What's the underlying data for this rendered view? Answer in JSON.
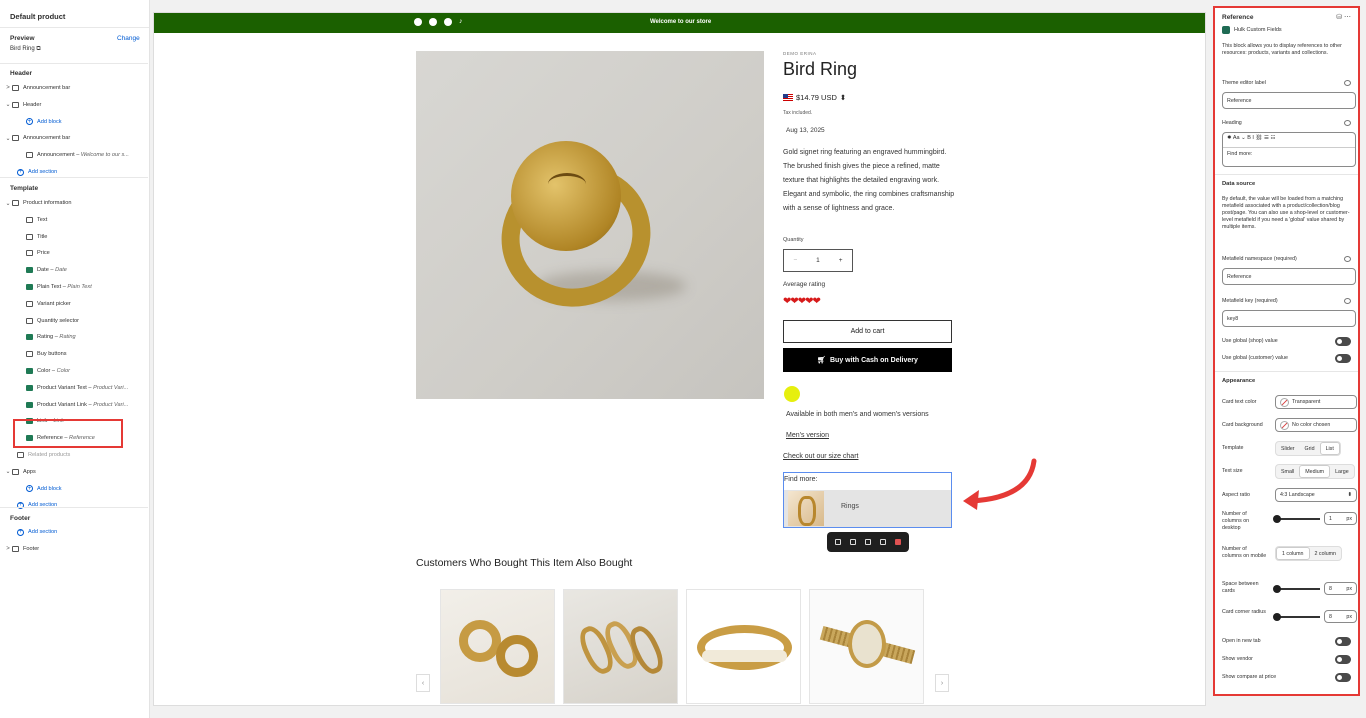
{
  "left": {
    "title": "Default product",
    "preview_label": "Preview",
    "preview_change": "Change",
    "preview_value": "Bird Ring",
    "header_section": "Header",
    "header_items": [
      {
        "label": "Announcement bar",
        "caret": ">",
        "icon": "section-icon"
      },
      {
        "label": "Header",
        "caret": "⌄",
        "icon": "section-icon"
      },
      {
        "label": "Add block",
        "type": "add"
      },
      {
        "label": "Announcement bar",
        "caret": "⌄",
        "icon": "section-icon"
      },
      {
        "label": "Announcement",
        "sub": "Welcome to our s...",
        "icon": "block-icon"
      },
      {
        "label": "Add section",
        "type": "add"
      }
    ],
    "template_section": "Template",
    "template_items": [
      {
        "label": "Product information",
        "caret": "⌄"
      },
      {
        "label": "Text"
      },
      {
        "label": "Title"
      },
      {
        "label": "Price"
      },
      {
        "label": "Date",
        "sub": "Date",
        "app": true
      },
      {
        "label": "Plain Text",
        "sub": "Plain Text",
        "app": true
      },
      {
        "label": "Variant picker"
      },
      {
        "label": "Quantity selector"
      },
      {
        "label": "Rating",
        "sub": "Rating",
        "app": true
      },
      {
        "label": "Buy buttons"
      },
      {
        "label": "Color",
        "sub": "Color",
        "app": true
      },
      {
        "label": "Product Variant Text",
        "sub": "Product Vari...",
        "app": true
      },
      {
        "label": "Product Variant Link",
        "sub": "Product  Vari...",
        "app": true
      },
      {
        "label": "Link",
        "sub": "Link",
        "app": true
      },
      {
        "label": "Reference",
        "sub": "Reference",
        "app": true
      },
      {
        "label": "Related products"
      },
      {
        "label": "Apps",
        "caret": "⌄"
      },
      {
        "label": "Add block",
        "type": "add"
      },
      {
        "label": "Add section",
        "type": "add"
      }
    ],
    "footer_section": "Footer",
    "footer_items": [
      {
        "label": "Add section",
        "type": "add"
      },
      {
        "label": "Footer",
        "caret": ">"
      }
    ]
  },
  "store": {
    "announcement": "Welcome to our store",
    "brand": "DEMO ERINA",
    "title": "Bird Ring",
    "price": "$14.79 USD",
    "tax": "Tax included.",
    "date": "Aug 13, 2025",
    "description": "Gold signet ring featuring an engraved hummingbird. The brushed finish gives the piece a refined, matte texture that highlights the detailed engraving work. Elegant and symbolic, the ring combines craftsmanship with a sense of lightness and grace.",
    "quantity_label": "Quantity",
    "quantity_value": "1",
    "qty_minus": "−",
    "qty_plus": "+",
    "rating_label": "Average rating",
    "rating_value": 4.5,
    "rating_hearts": "❤❤❤❤❤",
    "add_to_cart": "Add to cart",
    "cod": "Buy with Cash on Delivery",
    "color_swatch": "#e6ef0e",
    "availability": "Available in both men's and women's versions",
    "mens_link": "Men's version",
    "size_chart": "Check out our size chart",
    "find_more": "Find more:",
    "ref_card_label": "Rings",
    "also_bought": "Customers Who Bought This Item Also Bought",
    "prev": "‹",
    "next": "›"
  },
  "panel": {
    "title": "Reference",
    "app_name": "Hulk Custom Fields",
    "intro": "This block allows you to display references to other resources: products, variants and collections.",
    "editor_label_title": "Theme editor label",
    "editor_label_value": "Reference",
    "heading_title": "Heading",
    "heading_value": "Find more:",
    "rte_tools": "✹  Aa ⌄  B  I  ⛓  ☰  ☷",
    "data_source_title": "Data source",
    "data_source_text": "By default, the value will be loaded from a matching metafield associated with a product/collection/blog post/page. You can also use a shop-level or customer-level metafield if you need a 'global' value shared by multiple items.",
    "ns_label": "Metafield namespace (required)",
    "ns_value": "Reference",
    "key_label": "Metafield key (required)",
    "key_value": "key8",
    "global_shop": "Use global (shop) value",
    "global_customer": "Use global (customer) value",
    "appearance_title": "Appearance",
    "card_text_color": "Card text color",
    "card_text_color_value": "Transparent",
    "card_bg": "Card background",
    "card_bg_value": "No color chosen",
    "template_label": "Template",
    "template_options": [
      "Slider",
      "Grid",
      "List"
    ],
    "template_selected": "List",
    "text_size_label": "Text size",
    "text_size_options": [
      "Small",
      "Medium",
      "Large"
    ],
    "text_size_selected": "Medium",
    "aspect_label": "Aspect ratio",
    "aspect_value": "4:3 Landscape",
    "cols_desktop_label": "Number of columns on desktop",
    "cols_desktop_value": "1",
    "cols_mobile_label": "Number of columns on mobile",
    "cols_mobile_options": [
      "1 column",
      "2 column"
    ],
    "space_label": "Space between cards",
    "space_value": "8",
    "radius_label": "Card corner radius",
    "radius_value": "8",
    "unit": "px",
    "open_new_tab": "Open in new tab",
    "show_vendor": "Show vendor",
    "show_compare": "Show compare at price"
  }
}
